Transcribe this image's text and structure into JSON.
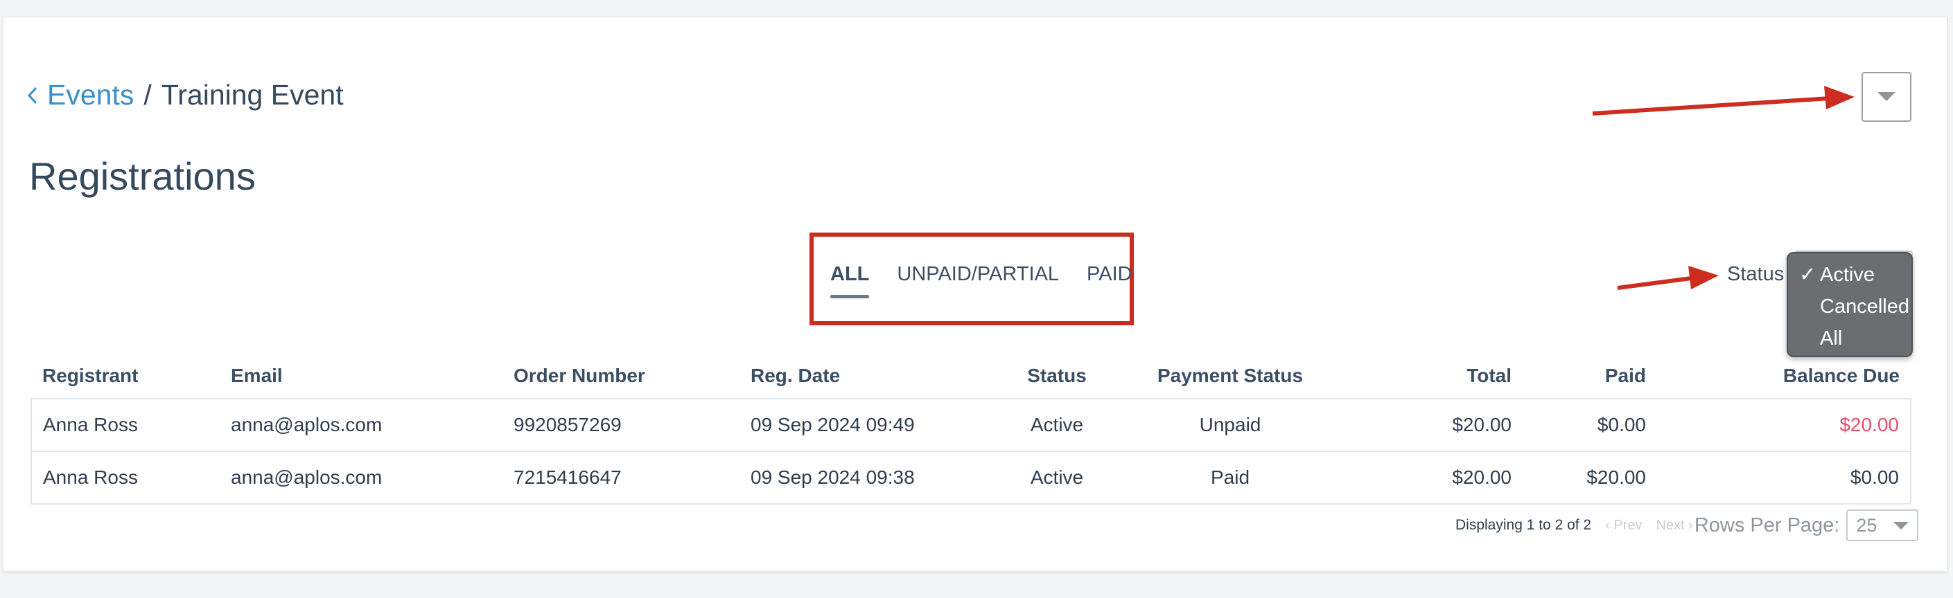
{
  "breadcrumb": {
    "back_label": "Events",
    "separator": "/",
    "current": "Training Event"
  },
  "page_title": "Registrations",
  "tabs": [
    {
      "label": "ALL",
      "active": true
    },
    {
      "label": "UNPAID/PARTIAL",
      "active": false
    },
    {
      "label": "PAID",
      "active": false
    }
  ],
  "status_filter": {
    "label": "Status",
    "options": [
      {
        "label": "Active",
        "checked": true
      },
      {
        "label": "Cancelled",
        "checked": false
      },
      {
        "label": "All",
        "checked": false
      }
    ],
    "check_mark": "✓"
  },
  "table": {
    "columns": [
      "Registrant",
      "Email",
      "Order Number",
      "Reg. Date",
      "Status",
      "Payment Status",
      "Total",
      "Paid",
      "Balance Due"
    ],
    "rows": [
      {
        "registrant": "Anna Ross",
        "email": "anna@aplos.com",
        "order": "9920857269",
        "date": "09 Sep 2024 09:49",
        "status": "Active",
        "payment_status": "Unpaid",
        "total": "$20.00",
        "paid": "$0.00",
        "due": "$20.00"
      },
      {
        "registrant": "Anna Ross",
        "email": "anna@aplos.com",
        "order": "7215416647",
        "date": "09 Sep 2024 09:38",
        "status": "Active",
        "payment_status": "Paid",
        "total": "$20.00",
        "paid": "$20.00",
        "due": "$0.00"
      }
    ]
  },
  "pagination": {
    "display_text": "Displaying 1 to 2 of 2",
    "prev_label": "‹ Prev",
    "next_label": "Next ›",
    "rows_per_page_label": "Rows Per Page:",
    "rows_per_page_value": "25"
  },
  "icons": {
    "back": "chevron-left-icon",
    "dropdown": "caret-down-icon"
  },
  "colors": {
    "link": "#3a8fc9",
    "annotation_red": "#cc2d1e",
    "due_red": "#e2516a"
  }
}
